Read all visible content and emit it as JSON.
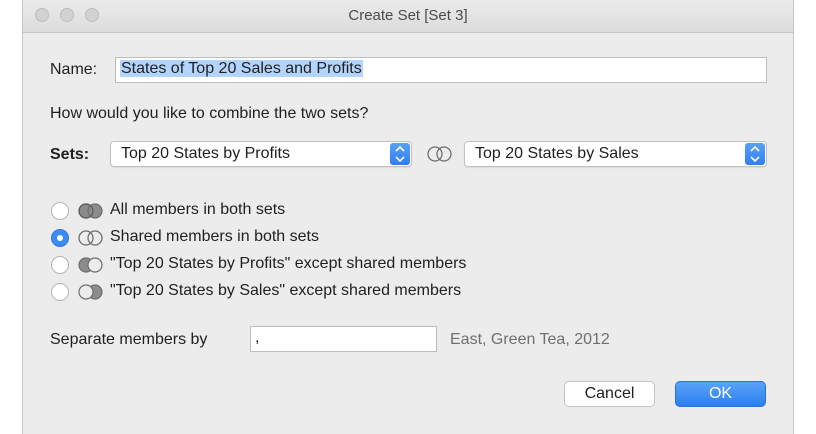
{
  "window": {
    "title": "Create Set [Set 3]"
  },
  "name": {
    "label": "Name:",
    "value": "States of Top 20 Sales and Profits"
  },
  "question": "How would you like to combine the two sets?",
  "sets": {
    "label": "Sets:",
    "left": "Top 20 States by Profits",
    "right": "Top 20 States by Sales",
    "combine_icon": "venn-intersection-icon"
  },
  "options": [
    {
      "label": "All members in both sets",
      "selected": false,
      "icon": "venn-union-icon"
    },
    {
      "label": "Shared members in both sets",
      "selected": true,
      "icon": "venn-intersection-icon"
    },
    {
      "label": "\"Top 20 States by Profits\" except shared members",
      "selected": false,
      "icon": "venn-left-except-icon"
    },
    {
      "label": "\"Top 20 States by Sales\" except shared members",
      "selected": false,
      "icon": "venn-right-except-icon"
    }
  ],
  "separator": {
    "label": "Separate members by",
    "value": ",",
    "example": "East, Green Tea, 2012"
  },
  "buttons": {
    "cancel": "Cancel",
    "ok": "OK"
  },
  "colors": {
    "accent": "#3b8cf5",
    "selection": "#b3d4fc"
  }
}
